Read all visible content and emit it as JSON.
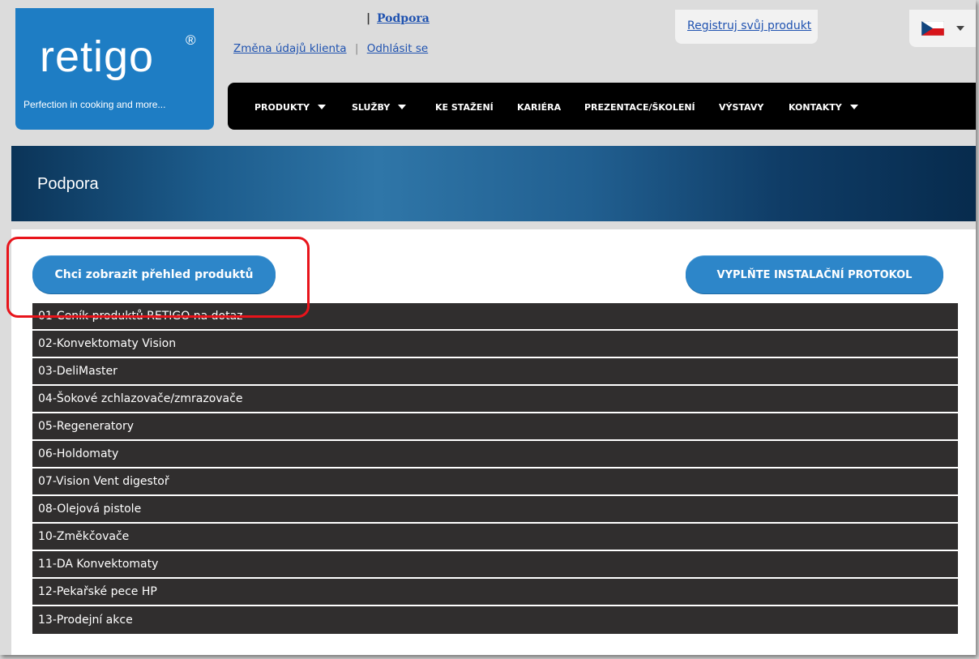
{
  "logo": {
    "word": "retigo",
    "reg": "®",
    "tagline": "Perfection in cooking and more..."
  },
  "breadcrumb": {
    "separator": "|",
    "current": "Podpora"
  },
  "account": {
    "change_details": "Změna údajů klienta",
    "separator": "|",
    "logout": "Odhlásit se"
  },
  "register": {
    "label": "Registruj svůj produkt"
  },
  "language": {
    "flag_icon": "czech-flag-icon"
  },
  "nav": {
    "items": [
      {
        "label": "PRODUKTY",
        "dropdown": true
      },
      {
        "label": "SLUŽBY",
        "dropdown": true
      },
      {
        "label": "KE STAŽENÍ",
        "dropdown": false
      },
      {
        "label": "KARIÉRA",
        "dropdown": false
      },
      {
        "label": "PREZENTACE/ŠKOLENÍ",
        "dropdown": false
      },
      {
        "label": "VÝSTAVY",
        "dropdown": false
      },
      {
        "label": "KONTAKTY",
        "dropdown": true
      }
    ]
  },
  "banner": {
    "title": "Podpora"
  },
  "buttons": {
    "products_overview": "Chci zobrazit přehled produktů",
    "install_protocol": "VYPLŇTE INSTALAČNÍ PROTOKOL"
  },
  "colors": {
    "accent": "#2d86c9",
    "highlight": "#e8141b",
    "row_bg": "#302e2e"
  },
  "list": [
    "01-Ceník produktů RETIGO na dotaz",
    "02-Konvektomaty Vision",
    "03-DeliMaster",
    "04-Šokové zchlazovače/zmrazovače",
    "05-Regeneratory",
    "06-Holdomaty",
    "07-Vision Vent digestoř",
    "08-Olejová pistole",
    "10-Změkčovače",
    "11-DA Konvektomaty",
    "12-Pekařské pece HP",
    "13-Prodejní akce"
  ]
}
